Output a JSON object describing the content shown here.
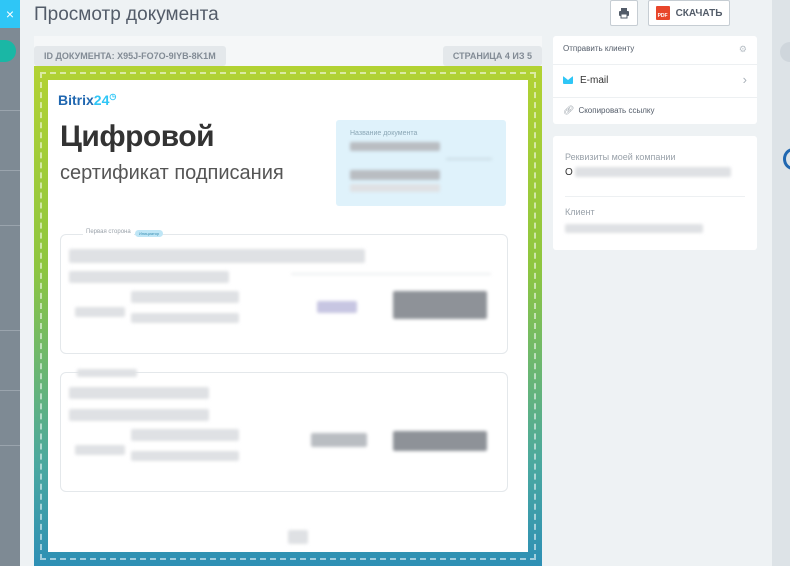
{
  "window": {
    "title": "Просмотр документа",
    "close_glyph": "×"
  },
  "toolbar": {
    "download_label": "СКАЧАТЬ",
    "pdf_badge": "PDF"
  },
  "document": {
    "id_label": "ID ДОКУМЕНТА: X95J-FO7O-9IYB-8K1M",
    "page_counter": "СТРАНИЦА 4 ИЗ 5"
  },
  "certificate": {
    "logo_main": "Bitrix",
    "logo_num": "24",
    "title": "Цифровой",
    "subtitle": "сертификат подписания",
    "doc_name_label": "Название документа",
    "first_party_label": "Первая сторона",
    "initiator_badge": "Инициатор"
  },
  "send_panel": {
    "header": "Отправить клиенту",
    "email_label": "E-mail",
    "copy_link": "Скопировать ссылку"
  },
  "details_panel": {
    "company_label": "Реквизиты моей компании",
    "company_value_prefix": "О",
    "client_label": "Клиент"
  }
}
